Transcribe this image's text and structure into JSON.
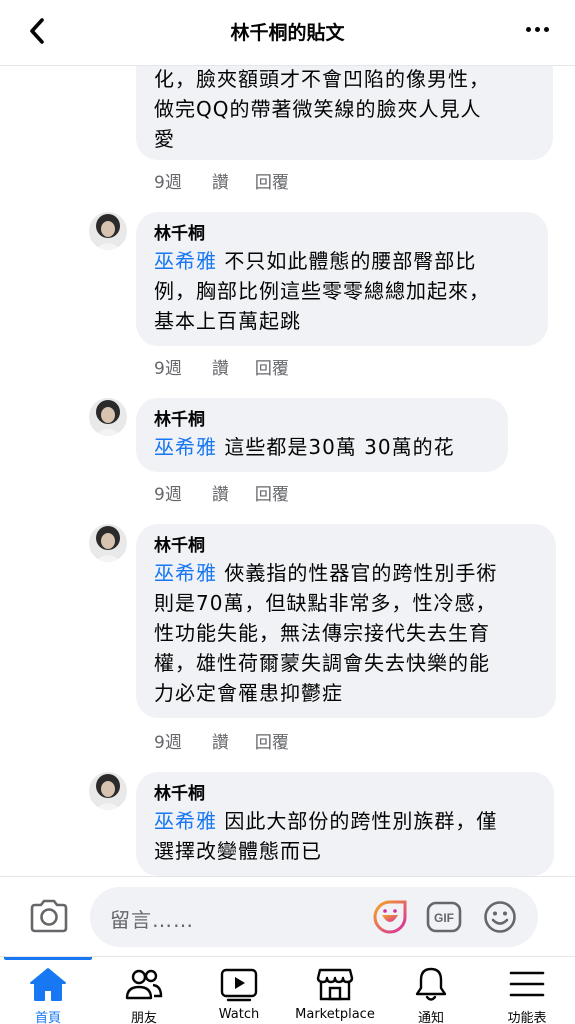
{
  "header": {
    "title": "林千桐的貼文"
  },
  "comments": [
    {
      "text": "化，臉夾額頭才不會凹陷的像男性，做完QQ的帶著微笑線的臉夾人見人愛",
      "lines": [
        "化，臉夾額頭才不會凹陷的像男性，",
        "做完QQ的帶著微笑線的臉夾人見人",
        "愛"
      ],
      "time": "9週",
      "like": "讚",
      "reply": "回覆"
    },
    {
      "author": "林千桐",
      "mention": "巫希雅",
      "lines": [
        "不只如此體態的腰部臀部比",
        "例，胸部比例這些零零總總加起來，",
        "基本上百萬起跳"
      ],
      "time": "9週",
      "like": "讚",
      "reply": "回覆"
    },
    {
      "author": "林千桐",
      "mention": "巫希雅",
      "lines": [
        "這些都是30萬 30萬的花"
      ],
      "time": "9週",
      "like": "讚",
      "reply": "回覆"
    },
    {
      "author": "林千桐",
      "mention": "巫希雅",
      "lines": [
        "俠義指的性器官的跨性別手術",
        "則是70萬，但缺點非常多，性冷感，",
        "性功能失能，無法傳宗接代失去生育",
        "權，雄性荷爾蒙失調會失去快樂的能",
        "力必定會罹患抑鬱症"
      ],
      "time": "9週",
      "like": "讚",
      "reply": "回覆"
    },
    {
      "author": "林千桐",
      "mention": "巫希雅",
      "lines": [
        "因此大部份的跨性別族群，僅",
        "選擇改變體態而已"
      ]
    }
  ],
  "composer": {
    "placeholder": "留言……"
  },
  "tabs": [
    {
      "label": "首頁",
      "icon": "home-icon",
      "active": true
    },
    {
      "label": "朋友",
      "icon": "friends-icon"
    },
    {
      "label": "Watch",
      "icon": "watch-icon"
    },
    {
      "label": "Marketplace",
      "icon": "marketplace-icon"
    },
    {
      "label": "通知",
      "icon": "bell-icon"
    },
    {
      "label": "功能表",
      "icon": "menu-icon"
    }
  ],
  "colors": {
    "accent": "#1877f2",
    "bubble": "#f0f2f5",
    "meta": "#65676b"
  }
}
